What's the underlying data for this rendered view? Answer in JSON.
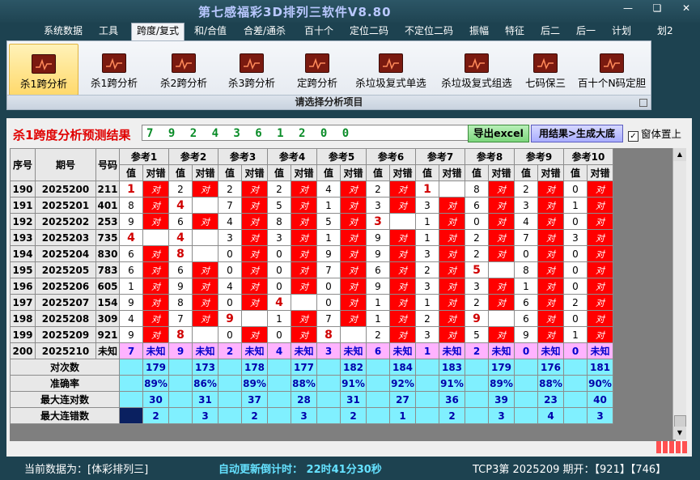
{
  "window": {
    "title": "第七感福彩3D排列三软件V8.80"
  },
  "menu": [
    "系统数据",
    "工具",
    "跨度/复式",
    "和/合值",
    "合差/通杀",
    "百十个",
    "定位二码",
    "不定位二码",
    "振幅",
    "特征",
    "后二",
    "后一",
    "计划",
    "划2"
  ],
  "menu_active": "跨度/复式",
  "ribbon": {
    "buttons": [
      "杀1跨分析",
      "杀1跨分析",
      "杀2跨分析",
      "杀3跨分析",
      "定跨分析",
      "杀垃圾复式单选",
      "杀垃圾复式组选",
      "七码保三",
      "百十个N码定胆"
    ],
    "group_label": "请选择分析项目"
  },
  "panel": {
    "title": "杀1跨度分析预测结果",
    "result": "7 9 2 4 3 6 1 2 0 0",
    "excel_button": "导出excel",
    "generate_button": "用结果>生成大底",
    "checkbox_label": "窗体置上",
    "checkbox_checked": true
  },
  "table": {
    "h_seq": "序号",
    "h_period": "期号",
    "h_code": "号码",
    "refs": [
      "参考1",
      "参考2",
      "参考3",
      "参考4",
      "参考5",
      "参考6",
      "参考7",
      "参考8",
      "参考9",
      "参考10"
    ],
    "sub_value": "值",
    "sub_result": "对错",
    "rows": [
      {
        "seq": "190",
        "period": "2025200",
        "code": "211",
        "vals": [
          "1",
          "2",
          "2",
          "2",
          "4",
          "2",
          "1",
          "8",
          "2",
          "0"
        ],
        "res": [
          "对",
          "对",
          "对",
          "对",
          "对",
          "对",
          "",
          "对",
          "对",
          "对"
        ],
        "big": [
          0,
          6
        ]
      },
      {
        "seq": "191",
        "period": "2025201",
        "code": "401",
        "vals": [
          "8",
          "4",
          "7",
          "5",
          "1",
          "3",
          "3",
          "6",
          "3",
          "1"
        ],
        "res": [
          "对",
          "",
          "对",
          "对",
          "对",
          "对",
          "对",
          "对",
          "对",
          "对"
        ],
        "big": [
          1
        ]
      },
      {
        "seq": "192",
        "period": "2025202",
        "code": "253",
        "vals": [
          "9",
          "6",
          "4",
          "8",
          "5",
          "3",
          "1",
          "0",
          "4",
          "0"
        ],
        "res": [
          "对",
          "对",
          "对",
          "对",
          "对",
          "",
          "对",
          "对",
          "对",
          "对"
        ],
        "big": [
          5
        ]
      },
      {
        "seq": "193",
        "period": "2025203",
        "code": "735",
        "vals": [
          "4",
          "4",
          "3",
          "3",
          "1",
          "9",
          "1",
          "2",
          "7",
          "3"
        ],
        "res": [
          "",
          "",
          "对",
          "对",
          "对",
          "对",
          "对",
          "对",
          "对",
          "对"
        ],
        "big": [
          0,
          1
        ]
      },
      {
        "seq": "194",
        "period": "2025204",
        "code": "830",
        "vals": [
          "6",
          "8",
          "0",
          "0",
          "9",
          "9",
          "3",
          "2",
          "0",
          "0"
        ],
        "res": [
          "对",
          "",
          "对",
          "对",
          "对",
          "对",
          "对",
          "对",
          "对",
          "对"
        ],
        "big": [
          1
        ]
      },
      {
        "seq": "195",
        "period": "2025205",
        "code": "783",
        "vals": [
          "6",
          "6",
          "0",
          "0",
          "7",
          "6",
          "2",
          "5",
          "8",
          "0"
        ],
        "res": [
          "对",
          "对",
          "对",
          "对",
          "对",
          "对",
          "对",
          "",
          "对",
          "对"
        ],
        "big": [
          7
        ]
      },
      {
        "seq": "196",
        "period": "2025206",
        "code": "605",
        "vals": [
          "1",
          "9",
          "4",
          "0",
          "0",
          "9",
          "3",
          "3",
          "1",
          "0"
        ],
        "res": [
          "对",
          "对",
          "对",
          "对",
          "对",
          "对",
          "对",
          "对",
          "对",
          "对"
        ],
        "big": []
      },
      {
        "seq": "197",
        "period": "2025207",
        "code": "154",
        "vals": [
          "9",
          "8",
          "0",
          "4",
          "0",
          "1",
          "1",
          "2",
          "6",
          "2"
        ],
        "res": [
          "对",
          "对",
          "对",
          "",
          "对",
          "对",
          "对",
          "对",
          "对",
          "对"
        ],
        "big": [
          3
        ]
      },
      {
        "seq": "198",
        "period": "2025208",
        "code": "309",
        "vals": [
          "4",
          "7",
          "9",
          "1",
          "7",
          "1",
          "2",
          "9",
          "6",
          "0"
        ],
        "res": [
          "对",
          "对",
          "",
          "对",
          "对",
          "对",
          "对",
          "",
          "对",
          "对"
        ],
        "big": [
          2,
          7
        ]
      },
      {
        "seq": "199",
        "period": "2025209",
        "code": "921",
        "vals": [
          "9",
          "8",
          "0",
          "0",
          "8",
          "2",
          "3",
          "5",
          "9",
          "1"
        ],
        "res": [
          "对",
          "",
          "对",
          "对",
          "",
          "对",
          "对",
          "对",
          "对",
          "对"
        ],
        "big": [
          1,
          4
        ]
      }
    ],
    "predict_row": {
      "seq": "200",
      "period": "2025210",
      "code": "未知",
      "vals": [
        "7",
        "9",
        "2",
        "4",
        "3",
        "6",
        "1",
        "2",
        "0",
        "0"
      ],
      "res_label": "未知"
    },
    "summary": [
      {
        "label": "对次数",
        "vals": [
          "179",
          "173",
          "178",
          "177",
          "182",
          "184",
          "183",
          "179",
          "176",
          "181"
        ]
      },
      {
        "label": "准确率",
        "vals": [
          "89%",
          "86%",
          "89%",
          "88%",
          "91%",
          "92%",
          "91%",
          "89%",
          "88%",
          "90%"
        ]
      },
      {
        "label": "最大连对数",
        "vals": [
          "30",
          "31",
          "37",
          "28",
          "31",
          "27",
          "36",
          "39",
          "23",
          "40"
        ]
      },
      {
        "label": "最大连错数",
        "vals": [
          "2",
          "3",
          "2",
          "3",
          "2",
          "1",
          "2",
          "3",
          "4",
          "3"
        ]
      }
    ]
  },
  "status": {
    "current_data": "当前数据为：[体彩排列三]",
    "countdown": "自动更新倒计时：  22时41分30秒",
    "draw_info": "TCP3第 2025209 期开：【921】【746】"
  },
  "colors": {
    "accent_red": "#ff0000",
    "predict_pink": "#ffb3ff",
    "summary_cyan": "#80f0ff",
    "bg": "#1d4250"
  }
}
